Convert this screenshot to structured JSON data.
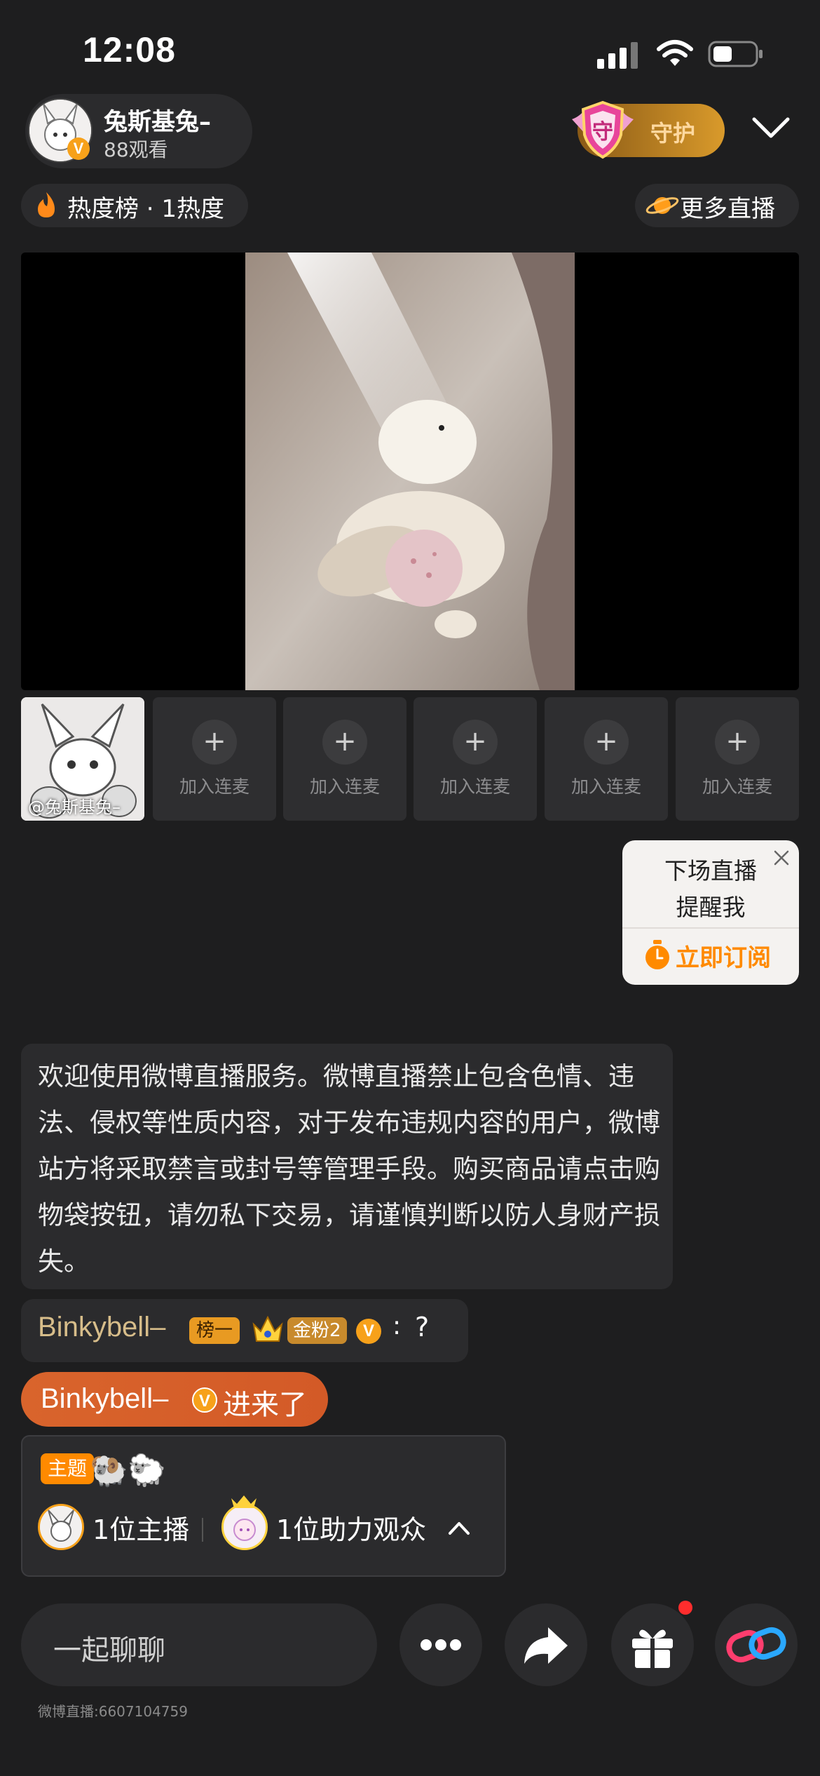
{
  "status_bar": {
    "time": "12:08"
  },
  "streamer": {
    "name": "兔斯基兔–",
    "viewers": "88观看",
    "verified_badge": "V"
  },
  "guard": {
    "label": "守护",
    "shield_glyph": "守"
  },
  "hot_rank": {
    "label": "热度榜 · 1热度"
  },
  "more_live": {
    "label": "更多直播"
  },
  "mic_slots": {
    "host_label": "@兔斯基兔–",
    "empty_label": "加入连麦",
    "plus": "+"
  },
  "reminder": {
    "line1": "下场直播",
    "line2": "提醒我",
    "button": "立即订阅"
  },
  "notice": {
    "text": "欢迎使用微博直播服务。微博直播禁止包含色情、违法、侵权等性质内容，对于发布违规内容的用户，微博站方将采取禁言或封号等管理手段。购买商品请点击购物袋按钮，请勿私下交易，请谨慎判断以防人身财产损失。"
  },
  "comment": {
    "user": "Binkybell–",
    "rank_tag": "榜一",
    "fans_tag": "金粉2",
    "v_badge": "V",
    "separator": ":",
    "text": "?"
  },
  "join_banner": {
    "user": "Binkybell–",
    "v_badge": "V",
    "text": "进来了"
  },
  "theme": {
    "tag": "主题",
    "emoji": [
      "🐏",
      "🐑"
    ],
    "host_count": "1位主播",
    "audience_count": "1位助力观众"
  },
  "bottom_bar": {
    "chat_placeholder": "一起聊聊",
    "room_id": "微博直播:6607104759"
  },
  "colors": {
    "accent": "#ff8a00",
    "background": "#1e1e1f",
    "card": "#2b2b2d",
    "join": "#d9642c"
  }
}
